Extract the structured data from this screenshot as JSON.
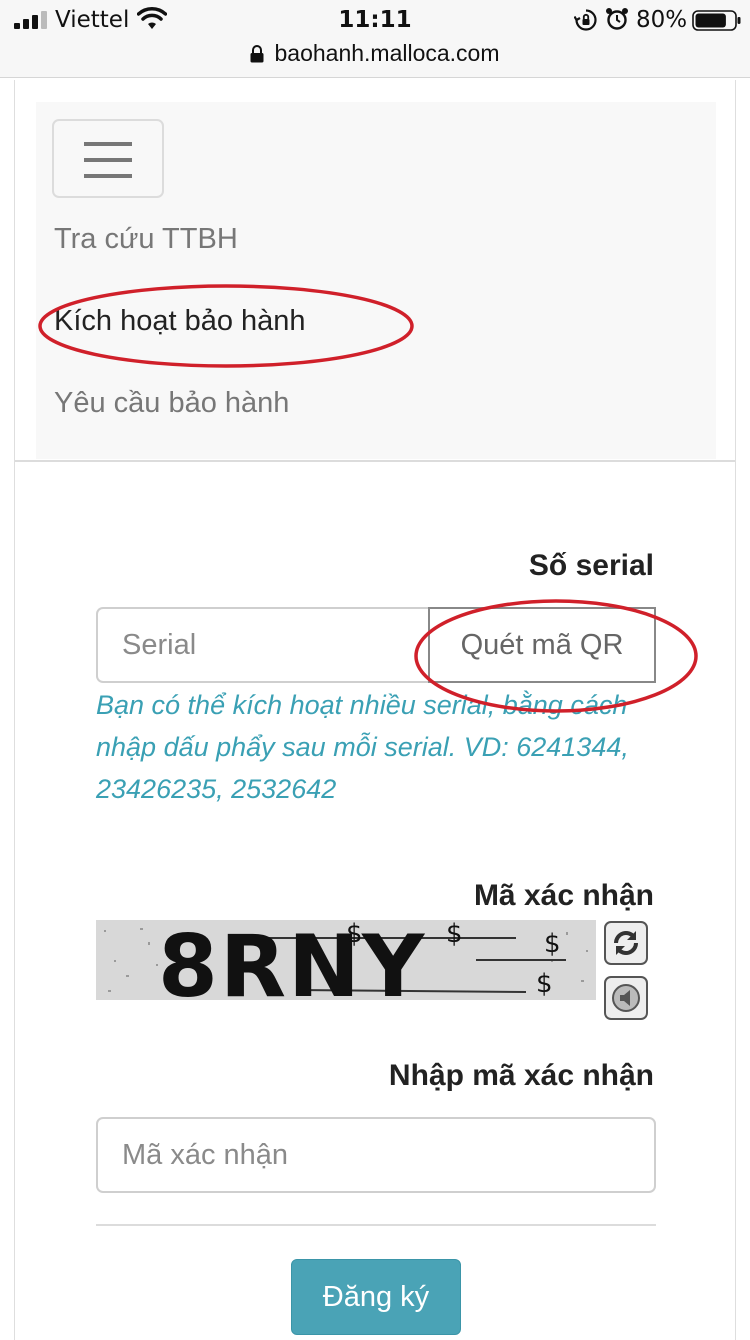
{
  "status_bar": {
    "carrier": "Viettel",
    "time": "11:11",
    "battery_percent": "80%",
    "battery_level": 0.8
  },
  "url_bar": {
    "url": "baohanh.malloca.com"
  },
  "nav": {
    "items": [
      {
        "label": "Tra cứu TTBH",
        "active": false
      },
      {
        "label": "Kích hoạt bảo hành",
        "active": true
      },
      {
        "label": "Yêu cầu bảo hành",
        "active": false
      }
    ]
  },
  "form": {
    "serial_label": "Số serial",
    "serial_placeholder": "Serial",
    "qr_button": "Quét mã QR",
    "help_text": "Bạn có thể kích hoạt nhiều serial, bằng cách nhập dấu phẩy sau mỗi serial. VD: 6241344, 23426235, 2532642",
    "captcha_label": "Mã xác nhận",
    "captcha_text": "8RNY",
    "code_label": "Nhập mã xác nhận",
    "code_placeholder": "Mã xác nhận",
    "submit_label": "Đăng ký"
  },
  "annotation_color": "#d0202a",
  "accent_color": "#4aa3b6"
}
